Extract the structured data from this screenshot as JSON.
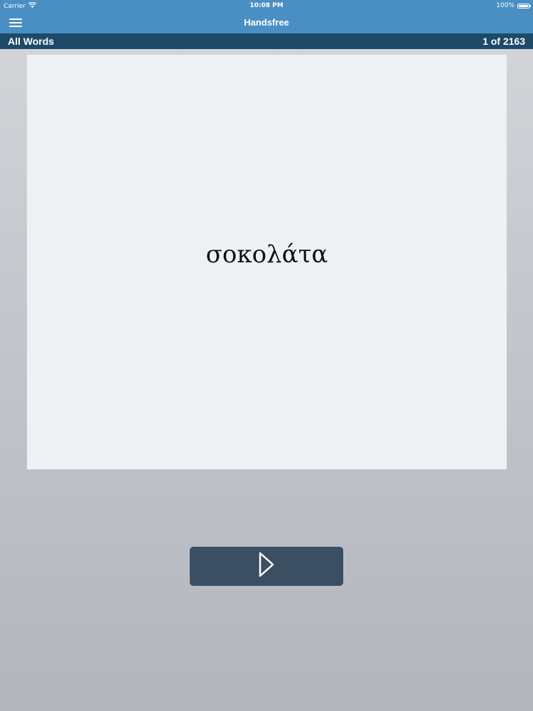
{
  "status_bar": {
    "carrier": "Carrier",
    "wifi_icon": "wifi-icon",
    "time": "10:08 PM",
    "battery_percent": "100%",
    "battery_level": 1.0
  },
  "nav_bar": {
    "menu_icon": "hamburger-menu-icon",
    "title": "Handsfree"
  },
  "sub_bar": {
    "list_name": "All Words",
    "counter": "1 of 2163"
  },
  "card": {
    "word": "σοκολάτα"
  },
  "controls": {
    "play_icon": "play-icon"
  },
  "colors": {
    "nav_blue": "#4a8fc3",
    "sub_bar_navy": "#1e4a6a",
    "card_bg": "#eef1f4",
    "button_bg": "#3b4f63"
  }
}
